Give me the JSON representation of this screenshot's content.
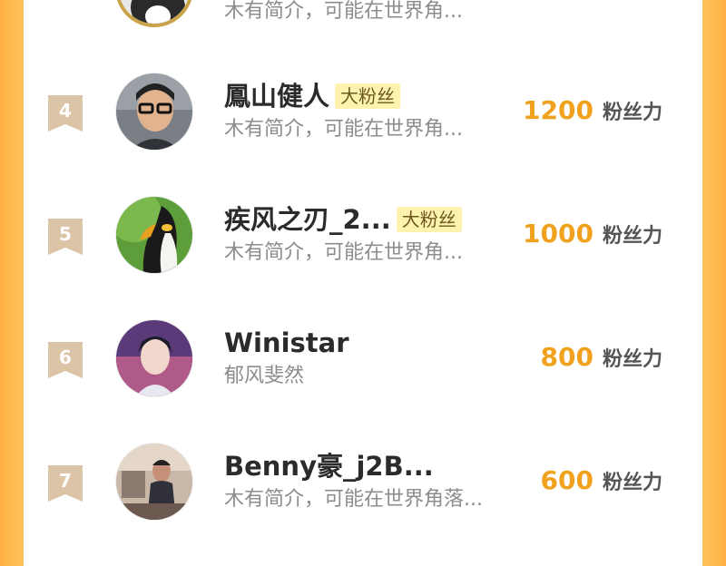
{
  "leaderboard": {
    "top_partial": {
      "bio": "木有简介，可能在世界角..."
    },
    "rows": [
      {
        "rank": "4",
        "name": "鳳山健人",
        "badge": "大粉丝",
        "bio": "木有简介，可能在世界角...",
        "score": "1200",
        "unit": "粉丝力",
        "avatar_icon": "man-with-glasses-avatar"
      },
      {
        "rank": "5",
        "name": "疾风之刃_2...",
        "badge": "大粉丝",
        "bio": "木有简介，可能在世界角...",
        "score": "1000",
        "unit": "粉丝力",
        "avatar_icon": "penguin-avatar"
      },
      {
        "rank": "6",
        "name": "Winistar",
        "badge": "",
        "bio": "郁风斐然",
        "score": "800",
        "unit": "粉丝力",
        "avatar_icon": "anime-character-avatar"
      },
      {
        "rank": "7",
        "name": "Benny豪_j2B...",
        "badge": "",
        "bio": "木有简介，可能在世界角落...",
        "score": "600",
        "unit": "粉丝力",
        "avatar_icon": "person-photo-avatar"
      }
    ]
  },
  "colors": {
    "background": "#ffc25a",
    "score": "#f0a21e",
    "badge_bg": "#fff1ae",
    "rank_ribbon": "#d8c0a0"
  }
}
